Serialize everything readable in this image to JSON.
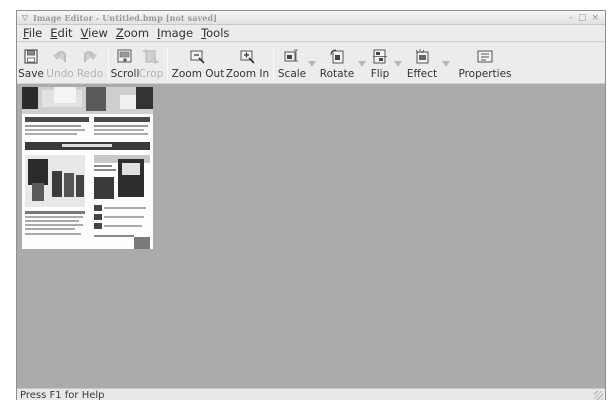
{
  "window": {
    "title": "Image Editor - Untitled.bmp [not saved]",
    "menu_glyph": "▽",
    "minimize_glyph": "–",
    "maximize_glyph": "□",
    "close_glyph": "×"
  },
  "menubar": [
    {
      "label": "File",
      "key": "F",
      "rest": "ile"
    },
    {
      "label": "Edit",
      "key": "E",
      "rest": "dit"
    },
    {
      "label": "View",
      "key": "V",
      "rest": "iew"
    },
    {
      "label": "Zoom",
      "key": "Z",
      "rest": "oom"
    },
    {
      "label": "Image",
      "key": "I",
      "rest": "mage"
    },
    {
      "label": "Tools",
      "key": "T",
      "rest": "ools"
    }
  ],
  "toolbar": {
    "save": {
      "label": "Save",
      "icon": "floppy-disk-icon",
      "enabled": true
    },
    "undo": {
      "label": "Undo",
      "icon": "undo-arrow-icon",
      "enabled": false
    },
    "redo": {
      "label": "Redo",
      "icon": "redo-arrow-icon",
      "enabled": false
    },
    "scroll": {
      "label": "Scroll",
      "icon": "scroll-hand-icon",
      "enabled": true
    },
    "crop": {
      "label": "Crop",
      "icon": "crop-icon",
      "enabled": false
    },
    "zoom_out": {
      "label": "Zoom Out",
      "icon": "zoom-out-icon",
      "enabled": true
    },
    "zoom_in": {
      "label": "Zoom In",
      "icon": "zoom-in-icon",
      "enabled": true
    },
    "scale": {
      "label": "Scale",
      "icon": "scale-icon",
      "enabled": true
    },
    "rotate": {
      "label": "Rotate",
      "icon": "rotate-icon",
      "enabled": true
    },
    "flip": {
      "label": "Flip",
      "icon": "flip-icon",
      "enabled": true
    },
    "effect": {
      "label": "Effect",
      "icon": "effect-icon",
      "enabled": true
    },
    "properties": {
      "label": "Properties",
      "icon": "properties-icon",
      "enabled": true
    }
  },
  "status": {
    "text": "Press F1 for Help"
  },
  "colors": {
    "canvas_background": "#ababab",
    "window_background": "#e6e6e6"
  }
}
